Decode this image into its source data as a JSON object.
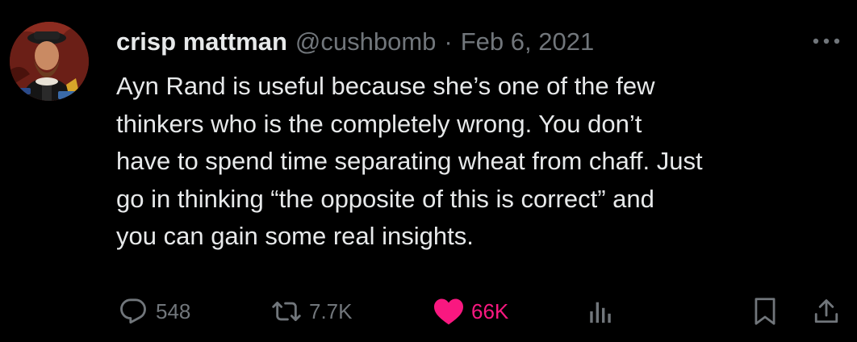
{
  "tweet": {
    "author": {
      "display_name": "crisp mattman",
      "handle": "@cushbomb"
    },
    "separator": "·",
    "date": "Feb 6, 2021",
    "text": "Ayn Rand is useful because she’s one of the few\nthinkers who is the completely wrong. You don’t\nhave to spend time separating wheat from chaff. Just\ngo in thinking “the opposite of this is correct” and\nyou can gain some real insights.",
    "actions": {
      "reply_count": "548",
      "retweet_count": "7.7K",
      "like_count": "66K"
    },
    "icons": {
      "more": "more-dots-icon",
      "reply": "reply-bubble-icon",
      "retweet": "retweet-icon",
      "like": "heart-icon",
      "views": "bar-chart-icon",
      "bookmark": "bookmark-icon",
      "share": "share-upload-icon"
    },
    "colors": {
      "background": "#000000",
      "primary_text": "#e7e9ea",
      "secondary_text": "#71767b",
      "like_active": "#f91880"
    }
  }
}
